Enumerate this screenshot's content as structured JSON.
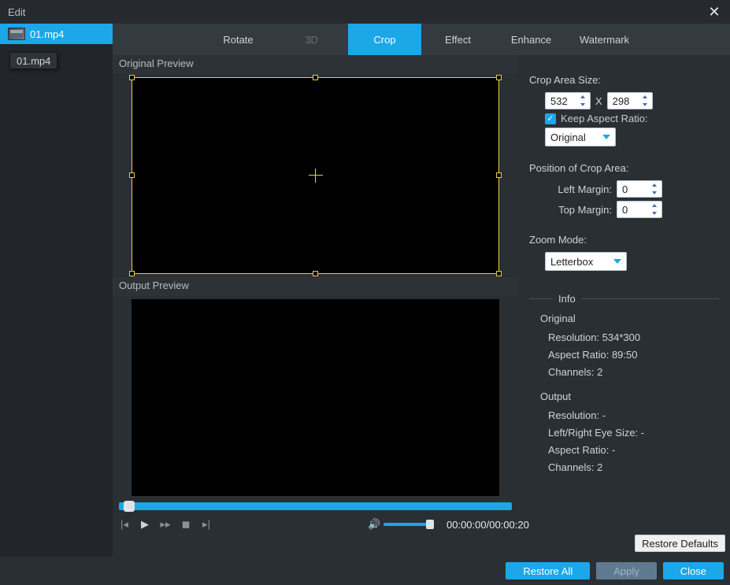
{
  "window": {
    "title": "Edit",
    "close": "✕"
  },
  "sidebar": {
    "items": [
      {
        "label": "01.mp4"
      }
    ],
    "dragged_label": "01.mp4"
  },
  "tabs": [
    {
      "label": "Rotate",
      "active": false,
      "disabled": false
    },
    {
      "label": "3D",
      "active": false,
      "disabled": true
    },
    {
      "label": "Crop",
      "active": true,
      "disabled": false
    },
    {
      "label": "Effect",
      "active": false,
      "disabled": false
    },
    {
      "label": "Enhance",
      "active": false,
      "disabled": false
    },
    {
      "label": "Watermark",
      "active": false,
      "disabled": false
    }
  ],
  "preview": {
    "original_label": "Original Preview",
    "output_label": "Output Preview"
  },
  "playback": {
    "time_display": "00:00:00/00:00:20"
  },
  "crop": {
    "area_size_label": "Crop Area Size:",
    "width": "532",
    "height": "298",
    "sep": "X",
    "keep_aspect_label": "Keep Aspect Ratio:",
    "keep_aspect_checked": true,
    "aspect_select": "Original"
  },
  "position": {
    "label": "Position of Crop Area:",
    "left_label": "Left Margin:",
    "left_value": "0",
    "top_label": "Top Margin:",
    "top_value": "0"
  },
  "zoom": {
    "label": "Zoom Mode:",
    "value": "Letterbox"
  },
  "info": {
    "header": "Info",
    "original": {
      "title": "Original",
      "resolution_label": "Resolution:",
      "resolution_value": "534*300",
      "aspect_label": "Aspect Ratio:",
      "aspect_value": "89:50",
      "channels_label": "Channels:",
      "channels_value": "2"
    },
    "output": {
      "title": "Output",
      "resolution_label": "Resolution:",
      "resolution_value": "-",
      "eye_label": "Left/Right Eye Size:",
      "eye_value": "-",
      "aspect_label": "Aspect Ratio:",
      "aspect_value": "-",
      "channels_label": "Channels:",
      "channels_value": "2"
    }
  },
  "buttons": {
    "restore_defaults": "Restore Defaults",
    "restore_all": "Restore All",
    "apply": "Apply",
    "close": "Close"
  }
}
